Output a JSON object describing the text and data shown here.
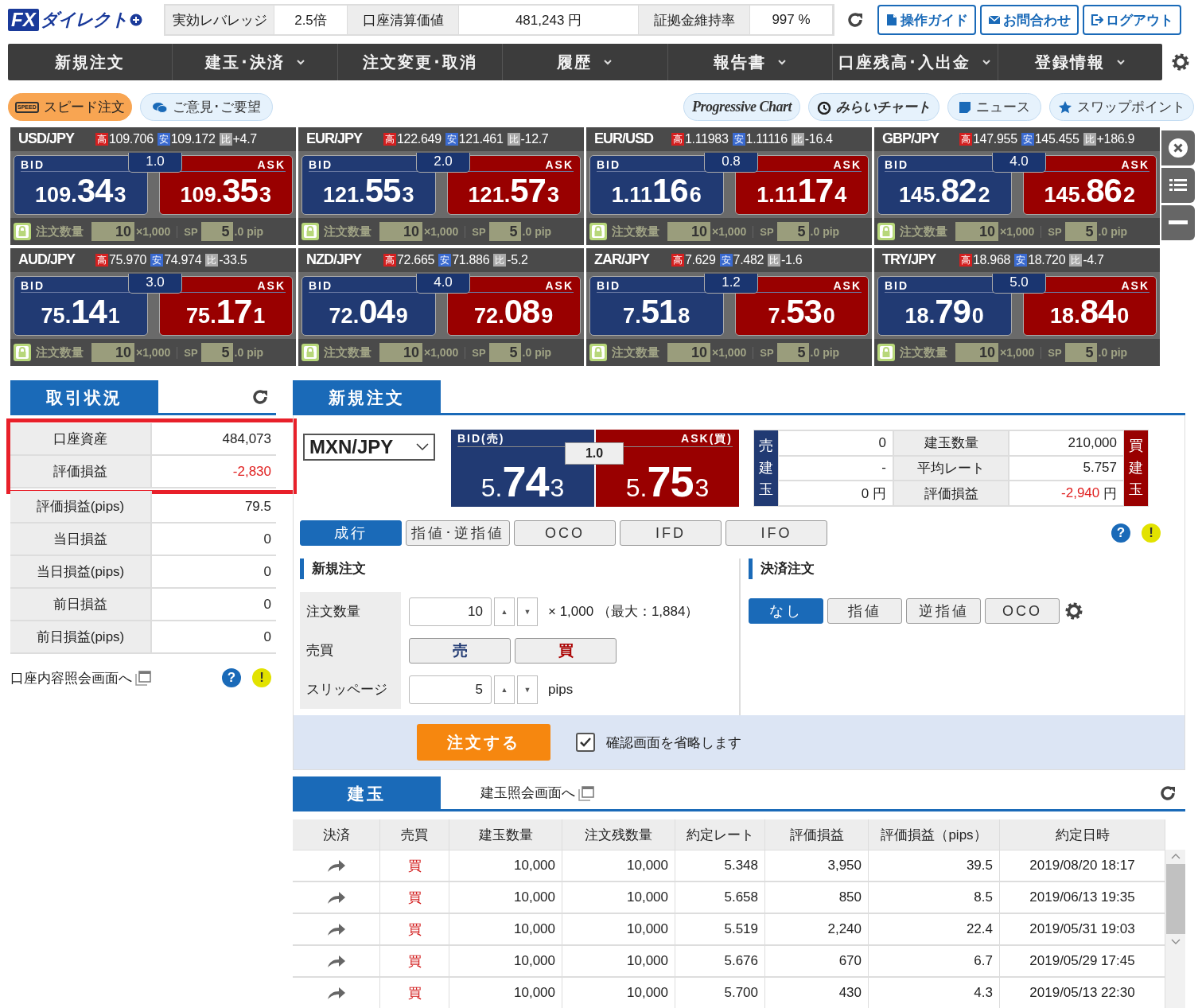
{
  "header": {
    "logo_fx": "FX",
    "logo_text": "ダイレクト",
    "stats": [
      {
        "label": "実効レバレッジ",
        "value": "2.5倍"
      },
      {
        "label": "口座清算価値",
        "value": "481,243 円"
      },
      {
        "label": "証拠金維持率",
        "value": "997 %"
      }
    ],
    "buttons": [
      {
        "label": "操作ガイド",
        "kind": "doc"
      },
      {
        "label": "お問合わせ",
        "kind": "mail"
      },
      {
        "label": "ログアウト",
        "kind": "logout"
      }
    ]
  },
  "nav": [
    {
      "label": "新規注文",
      "dropdown": false
    },
    {
      "label": "建玉･決済",
      "dropdown": true
    },
    {
      "label": "注文変更･取消",
      "dropdown": false
    },
    {
      "label": "履歴",
      "dropdown": true
    },
    {
      "label": "報告書",
      "dropdown": true
    },
    {
      "label": "口座残高･入出金",
      "dropdown": true
    },
    {
      "label": "登録情報",
      "dropdown": true
    }
  ],
  "pills_left": [
    {
      "label": "スピード注文",
      "kind": "speed",
      "icon_text": "SPEED"
    },
    {
      "label": "ご意見･ご要望",
      "kind": "chat"
    }
  ],
  "pills_right": [
    {
      "label": "Progressive Chart",
      "kind": "progressive"
    },
    {
      "label": "みらいチャート",
      "kind": "mirai"
    },
    {
      "label": "ニュース",
      "kind": "news"
    },
    {
      "label": "スワップポイント",
      "kind": "star"
    }
  ],
  "tiles": [
    {
      "pair": "USD/JPY",
      "high": "109.706",
      "low": "109.172",
      "change": "+4.7",
      "spread": "1.0",
      "bid": [
        "109.",
        "34",
        "3"
      ],
      "ask": [
        "109.",
        "35",
        "3"
      ]
    },
    {
      "pair": "EUR/JPY",
      "high": "122.649",
      "low": "121.461",
      "change": "-12.7",
      "spread": "2.0",
      "bid": [
        "121.",
        "55",
        "3"
      ],
      "ask": [
        "121.",
        "57",
        "3"
      ]
    },
    {
      "pair": "EUR/USD",
      "high": "1.11983",
      "low": "1.11116",
      "change": "-16.4",
      "spread": "0.8",
      "bid": [
        "1.11",
        "16",
        "6"
      ],
      "ask": [
        "1.11",
        "17",
        "4"
      ]
    },
    {
      "pair": "GBP/JPY",
      "high": "147.955",
      "low": "145.455",
      "change": "+186.9",
      "spread": "4.0",
      "bid": [
        "145.",
        "82",
        "2"
      ],
      "ask": [
        "145.",
        "86",
        "2"
      ]
    },
    {
      "pair": "AUD/JPY",
      "high": "75.970",
      "low": "74.974",
      "change": "-33.5",
      "spread": "3.0",
      "bid": [
        "75.",
        "14",
        "1"
      ],
      "ask": [
        "75.",
        "17",
        "1"
      ]
    },
    {
      "pair": "NZD/JPY",
      "high": "72.665",
      "low": "71.886",
      "change": "-5.2",
      "spread": "4.0",
      "bid": [
        "72.",
        "04",
        "9"
      ],
      "ask": [
        "72.",
        "08",
        "9"
      ]
    },
    {
      "pair": "ZAR/JPY",
      "high": "7.629",
      "low": "7.482",
      "change": "-1.6",
      "spread": "1.2",
      "bid": [
        "7.",
        "51",
        "8"
      ],
      "ask": [
        "7.",
        "53",
        "0"
      ]
    },
    {
      "pair": "TRY/JPY",
      "high": "18.968",
      "low": "18.720",
      "change": "-4.7",
      "spread": "5.0",
      "bid": [
        "18.",
        "79",
        "0"
      ],
      "ask": [
        "18.",
        "84",
        "0"
      ]
    }
  ],
  "tile_labels": [
    {
      "high": "高",
      "low": "安",
      "change": "比",
      "bid": "BID",
      "ask": "ASK",
      "qty_label": "注文数量",
      "qty": "10",
      "unit": "×1,000",
      "sp_label": "SP",
      "sp": "5",
      "sp_unit": ".0 pip"
    },
    {
      "high": "高",
      "low": "安",
      "change": "比",
      "bid": "BID",
      "ask": "ASK",
      "qty_label": "注文数量",
      "qty": "10",
      "unit": "×1,000",
      "sp_label": "SP",
      "sp": "5",
      "sp_unit": ".0 pip"
    },
    {
      "high": "高",
      "low": "安",
      "change": "比",
      "bid": "BID",
      "ask": "ASK",
      "qty_label": "注文数量",
      "qty": "10",
      "unit": "×1,000",
      "sp_label": "SP",
      "sp": "5",
      "sp_unit": ".0 pip"
    },
    {
      "high": "高",
      "low": "安",
      "change": "比",
      "bid": "BID",
      "ask": "ASK",
      "qty_label": "注文数量",
      "qty": "10",
      "unit": "×1,000",
      "sp_label": "SP",
      "sp": "5",
      "sp_unit": ".0 pip"
    },
    {
      "high": "高",
      "low": "安",
      "change": "比",
      "bid": "BID",
      "ask": "ASK",
      "qty_label": "注文数量",
      "qty": "10",
      "unit": "×1,000",
      "sp_label": "SP",
      "sp": "5",
      "sp_unit": ".0 pip"
    },
    {
      "high": "高",
      "low": "安",
      "change": "比",
      "bid": "BID",
      "ask": "ASK",
      "qty_label": "注文数量",
      "qty": "10",
      "unit": "×1,000",
      "sp_label": "SP",
      "sp": "5",
      "sp_unit": ".0 pip"
    },
    {
      "high": "高",
      "low": "安",
      "change": "比",
      "bid": "BID",
      "ask": "ASK",
      "qty_label": "注文数量",
      "qty": "10",
      "unit": "×1,000",
      "sp_label": "SP",
      "sp": "5",
      "sp_unit": ".0 pip"
    },
    {
      "high": "高",
      "low": "安",
      "change": "比",
      "bid": "BID",
      "ask": "ASK",
      "qty_label": "注文数量",
      "qty": "10",
      "unit": "×1,000",
      "sp_label": "SP",
      "sp": "5",
      "sp_unit": ".0 pip"
    }
  ],
  "account": {
    "title": "取引状況",
    "rows": [
      {
        "label": "口座資産",
        "value": "484,073",
        "negative": false,
        "highlighted": true
      },
      {
        "label": "評価損益",
        "value": "-2,830",
        "negative": true,
        "highlighted": true
      },
      {
        "label": "評価損益(pips)",
        "value": "79.5",
        "negative": false,
        "highlighted": false
      },
      {
        "label": "当日損益",
        "value": "0",
        "negative": false,
        "highlighted": false
      },
      {
        "label": "当日損益(pips)",
        "value": "0",
        "negative": false,
        "highlighted": false
      },
      {
        "label": "前日損益",
        "value": "0",
        "negative": false,
        "highlighted": false
      },
      {
        "label": "前日損益(pips)",
        "value": "0",
        "negative": false,
        "highlighted": false
      }
    ],
    "link": "口座内容照会画面へ",
    "help": "?",
    "notice": "!"
  },
  "order": {
    "title": "新規注文",
    "symbol": "MXN/JPY",
    "spread": "1.0",
    "bid": {
      "label": "BID(売)",
      "price": [
        "5.",
        "74",
        "3"
      ]
    },
    "ask": {
      "label": "ASK(買)",
      "price": [
        "5.",
        "75",
        "3"
      ]
    },
    "summary": {
      "sell_label": "売建玉",
      "buy_label": "買建玉",
      "rows": [
        {
          "sell": "0",
          "label": "建玉数量",
          "buy": "210,000",
          "negative": false
        },
        {
          "sell": "-",
          "label": "平均レート",
          "buy": "5.757",
          "negative": false
        },
        {
          "sell": "0 円",
          "label": "評価損益",
          "buy": "-2,940",
          "unit": "円",
          "negative": true
        }
      ]
    },
    "types": [
      {
        "label": "成行",
        "selected": true
      },
      {
        "label": "指値･逆指値",
        "selected": false
      },
      {
        "label": "OCO",
        "selected": false
      },
      {
        "label": "IFD",
        "selected": false
      },
      {
        "label": "IFO",
        "selected": false
      }
    ],
    "help": "?",
    "notice": "!",
    "entry": {
      "title": "新規注文",
      "fields": [
        {
          "kind": "stepper",
          "label": "注文数量",
          "value": "10",
          "up": "▲",
          "down": "▼",
          "suffix": "× 1,000 （最大：1,884）"
        },
        {
          "kind": "side",
          "label": "売買",
          "buttons": [
            {
              "label": "売",
              "kind": "sell"
            },
            {
              "label": "買",
              "kind": "buy"
            }
          ]
        },
        {
          "kind": "stepper",
          "label": "スリッページ",
          "value": "5",
          "up": "▲",
          "down": "▼",
          "suffix": "pips"
        }
      ]
    },
    "exit": {
      "title": "決済注文",
      "options": [
        {
          "label": "なし",
          "selected": true
        },
        {
          "label": "指値",
          "selected": false
        },
        {
          "label": "逆指値",
          "selected": false
        },
        {
          "label": "OCO",
          "selected": false
        }
      ]
    },
    "submit": "注文する",
    "confirm": {
      "label": "確認画面を省略します",
      "checked": true
    }
  },
  "positions": {
    "title": "建玉",
    "link": "建玉照会画面へ",
    "columns": [
      "決済",
      "売買",
      "建玉数量",
      "注文残数量",
      "約定レート",
      "評価損益",
      "評価損益（pips）",
      "約定日時"
    ],
    "rows": [
      {
        "side": "買",
        "kind": "buy",
        "qty": "10,000",
        "remain": "10,000",
        "rate": "5.348",
        "pl": "3,950",
        "pips": "39.5",
        "time": "2019/08/20 18:17"
      },
      {
        "side": "買",
        "kind": "buy",
        "qty": "10,000",
        "remain": "10,000",
        "rate": "5.658",
        "pl": "850",
        "pips": "8.5",
        "time": "2019/06/13 19:35"
      },
      {
        "side": "買",
        "kind": "buy",
        "qty": "10,000",
        "remain": "10,000",
        "rate": "5.519",
        "pl": "2,240",
        "pips": "22.4",
        "time": "2019/05/31 19:03"
      },
      {
        "side": "買",
        "kind": "buy",
        "qty": "10,000",
        "remain": "10,000",
        "rate": "5.676",
        "pl": "670",
        "pips": "6.7",
        "time": "2019/05/29 17:45"
      },
      {
        "side": "買",
        "kind": "buy",
        "qty": "10,000",
        "remain": "10,000",
        "rate": "5.700",
        "pl": "430",
        "pips": "4.3",
        "time": "2019/05/13 22:30"
      }
    ]
  }
}
